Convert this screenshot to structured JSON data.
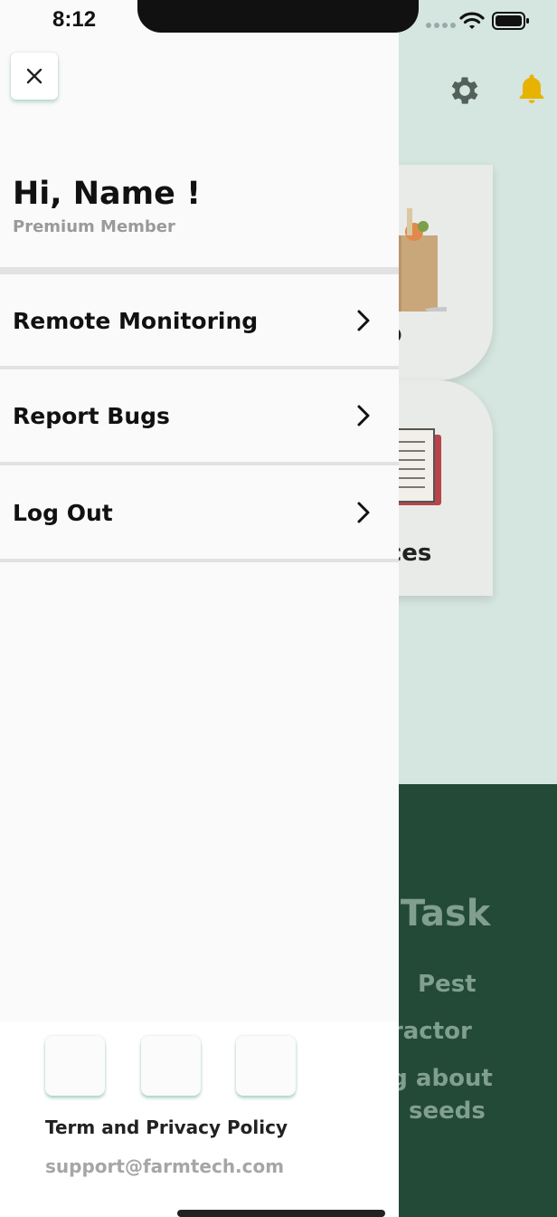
{
  "status_bar": {
    "time": "8:12"
  },
  "drawer": {
    "close_icon": "close-icon",
    "greeting": "Hi, Name !",
    "membership": "Premium Member",
    "menu": [
      {
        "label": "Remote Monitoring",
        "icon": "chevron-right-icon"
      },
      {
        "label": "Report Bugs",
        "icon": "chevron-right-icon"
      },
      {
        "label": "Log Out",
        "icon": "chevron-right-icon"
      }
    ],
    "footer": {
      "terms": "Term and Privacy Policy",
      "email": "support@farmtech.com"
    }
  },
  "background": {
    "cards": [
      {
        "label_visible": "p"
      },
      {
        "label_visible": "rces"
      }
    ],
    "task_title": "jor Task",
    "task_lines": [
      "Pest",
      "nt Tractor",
      "rnig about",
      "seeds"
    ]
  },
  "colors": {
    "drawer_bg": "#fafafa",
    "background_tint": "#d5e5df",
    "task_panel": "#234a36",
    "bell": "#e6b400",
    "accent_shadow": "#6eb496"
  }
}
